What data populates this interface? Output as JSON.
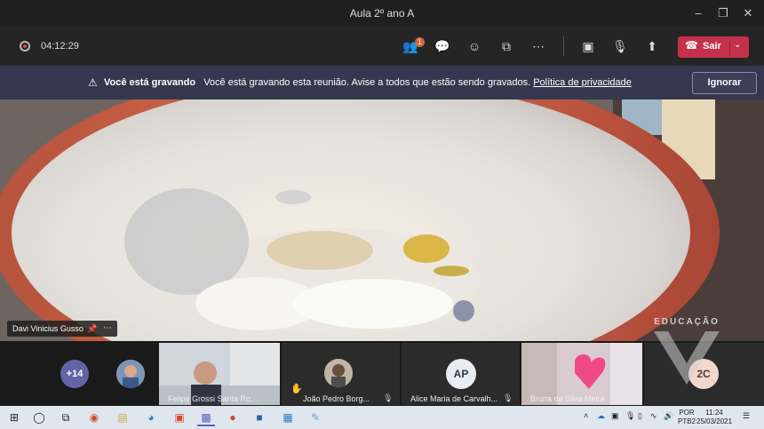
{
  "window": {
    "title": "Aula 2º ano A",
    "minimize_icon": "minimize-icon",
    "maximize_icon": "restore-icon",
    "close_icon": "close-icon"
  },
  "toolbar": {
    "recording_time": "04:12:29",
    "participants_badge": "1",
    "leave_label": "Sair"
  },
  "banner": {
    "heading": "Você está gravando",
    "message": "Você está gravando esta reunião. Avise a todos que estão sendo gravados.",
    "link": "Política de privacidade",
    "dismiss_label": "Ignorar"
  },
  "main_video": {
    "presenter_name": "Davi Vinicius Gusso"
  },
  "participants": {
    "overflow_count": "+14",
    "tiles": [
      {
        "name": "Felipe Grossi Santa Ro..."
      },
      {
        "name": "João Pedro Borg..."
      },
      {
        "name": "Alice Maria de Carvalh...",
        "initials": "AP"
      },
      {
        "name": "Bruna da Silva Meira"
      },
      {
        "initials": "2C"
      }
    ]
  },
  "watermark": {
    "text": "EDUCAÇÃO"
  },
  "taskbar": {
    "language_line1": "POR",
    "language_line2": "PTB2",
    "time": "11:24",
    "date": "25/03/2021"
  },
  "colors": {
    "leave_button": "#c4314b",
    "banner_bg": "#34384f",
    "avatar_purple": "#6264a7",
    "recording_dot": "#e04848"
  }
}
